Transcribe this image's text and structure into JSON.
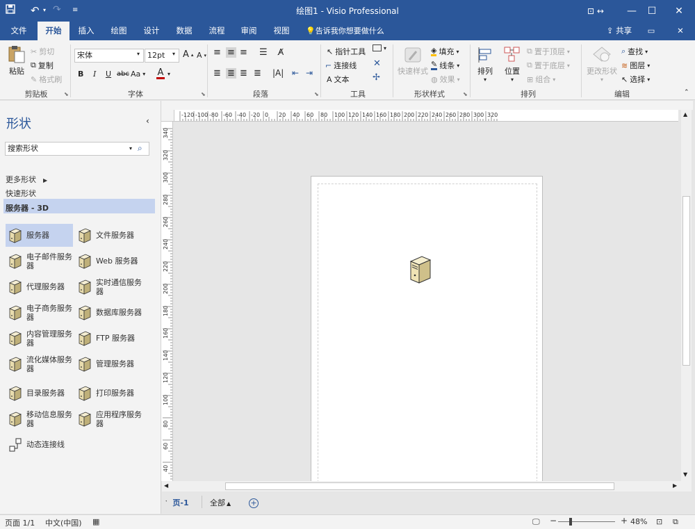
{
  "window": {
    "title": "绘图1  -  Visio Professional",
    "colors": {
      "accent": "#2b579a",
      "selection": "#c5d3ef"
    }
  },
  "tabs": [
    {
      "label": "文件"
    },
    {
      "label": "开始"
    },
    {
      "label": "插入"
    },
    {
      "label": "绘图"
    },
    {
      "label": "设计"
    },
    {
      "label": "数据"
    },
    {
      "label": "流程"
    },
    {
      "label": "审阅"
    },
    {
      "label": "视图"
    }
  ],
  "tell_me": "告诉我你想要做什么",
  "share": "共享",
  "ribbon": {
    "clipboard": {
      "paste": "粘贴",
      "cut": "剪切",
      "copy": "复制",
      "format_painter": "格式刷",
      "label": "剪贴板"
    },
    "font": {
      "name": "宋体",
      "size": "12pt",
      "label": "字体",
      "grow": "A",
      "shrink": "A",
      "bold": "B",
      "italic": "I",
      "underline": "U",
      "strike": "abc",
      "case": "Aa",
      "color": "A"
    },
    "paragraph": {
      "label": "段落"
    },
    "tools": {
      "pointer": "指针工具",
      "connector": "连接线",
      "text": "文本",
      "label": "工具"
    },
    "shape_styles": {
      "quick_styles": "快速样式",
      "fill": "填充",
      "line": "线条",
      "effects": "效果",
      "label": "形状样式"
    },
    "arrange": {
      "align": "排列",
      "position": "位置",
      "bring_front": "置于顶层",
      "send_back": "置于底层",
      "group": "组合",
      "label": "排列"
    },
    "editing": {
      "change_shape": "更改形状",
      "find": "查找",
      "layers": "图层",
      "select": "选择",
      "label": "编辑"
    }
  },
  "shapes_pane": {
    "title": "形状",
    "search_placeholder": "搜索形状",
    "more_shapes": "更多形状",
    "quick_shapes": "快速形状",
    "stencil": "服务器 - 3D",
    "items": [
      {
        "label": "服务器"
      },
      {
        "label": "文件服务器"
      },
      {
        "label": "电子邮件服务器"
      },
      {
        "label": "Web 服务器"
      },
      {
        "label": "代理服务器"
      },
      {
        "label": "实时通信服务器"
      },
      {
        "label": "电子商务服务器"
      },
      {
        "label": "数据库服务器"
      },
      {
        "label": "内容管理服务器"
      },
      {
        "label": "FTP 服务器"
      },
      {
        "label": "流化媒体服务器"
      },
      {
        "label": "管理服务器"
      },
      {
        "label": "目录服务器"
      },
      {
        "label": "打印服务器"
      },
      {
        "label": "移动信息服务器"
      },
      {
        "label": "应用程序服务器"
      },
      {
        "label": "动态连接线"
      }
    ]
  },
  "rulers": {
    "horizontal": [
      "-120",
      "-100",
      "-80",
      "-60",
      "-40",
      "-20",
      "0",
      "20",
      "40",
      "60",
      "80",
      "100",
      "120",
      "140",
      "160",
      "180",
      "200",
      "220",
      "240",
      "260",
      "280",
      "300",
      "320"
    ],
    "vertical": [
      "340",
      "320",
      "300",
      "280",
      "260",
      "240",
      "220",
      "200",
      "180",
      "160",
      "140",
      "120",
      "100",
      "80",
      "60",
      "40"
    ]
  },
  "page_tabs": {
    "current": "页-1",
    "all": "全部"
  },
  "status": {
    "page": "页面 1/1",
    "language": "中文(中国)",
    "zoom": "48%"
  }
}
